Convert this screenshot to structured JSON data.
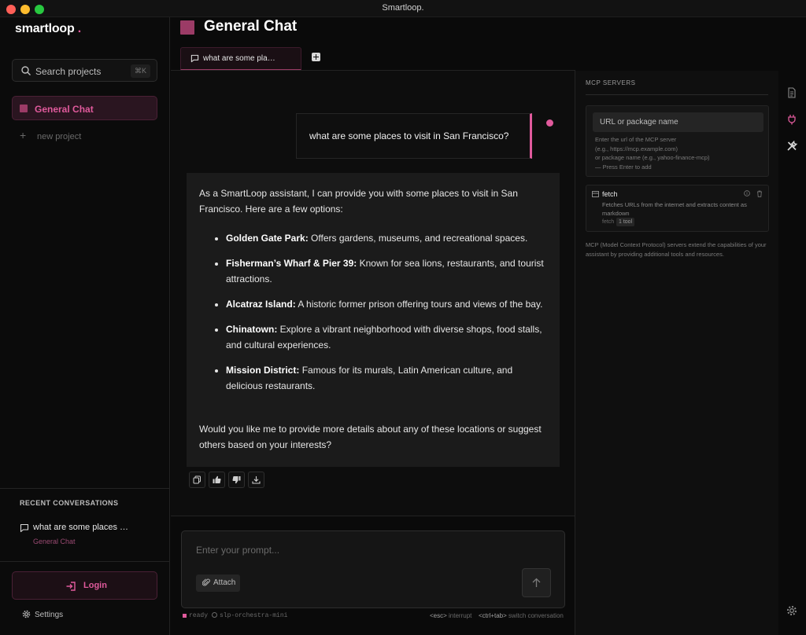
{
  "window": {
    "title": "Smartloop."
  },
  "sidebar": {
    "logo": "smartloop",
    "logo_dot": ".",
    "search": {
      "label": "Search projects",
      "shortcut": "⌘K"
    },
    "projects": [
      {
        "label": "General Chat"
      }
    ],
    "new_project_label": "new project",
    "recent_heading": "RECENT CONVERSATIONS",
    "recent": [
      {
        "title": "what are some places …",
        "project": "General Chat"
      }
    ],
    "login_label": "Login",
    "settings_label": "Settings"
  },
  "header": {
    "title": "General Chat",
    "tabs": [
      {
        "label": "what are some pla…"
      }
    ]
  },
  "chat": {
    "user_message": "what are some places to visit in San Francisco?",
    "assistant": {
      "intro": "As a SmartLoop assistant, I can provide you with some places to visit in San Francisco. Here are a few options:",
      "items": [
        {
          "title": "Golden Gate Park:",
          "text": " Offers gardens, museums, and recreational spaces."
        },
        {
          "title": "Fisherman’s Wharf & Pier 39:",
          "text": " Known for sea lions, restaurants, and tourist attractions."
        },
        {
          "title": "Alcatraz Island:",
          "text": " A historic former prison offering tours and views of the bay."
        },
        {
          "title": "Chinatown:",
          "text": " Explore a vibrant neighborhood with diverse shops, food stalls, and cultural experiences."
        },
        {
          "title": "Mission District:",
          "text": " Famous for its murals, Latin American culture, and delicious restaurants."
        }
      ],
      "outro": "Would you like me to provide more details about any of these locations or suggest others based on your interests?"
    }
  },
  "prompt": {
    "placeholder": "Enter your prompt...",
    "attach_label": "Attach"
  },
  "status": {
    "state": "ready",
    "model": "slp-orchestra-mini",
    "hint1_key": "<esc>",
    "hint1_text": " interrupt",
    "hint2_key": "<ctrl+tab>",
    "hint2_text": " switch conversation"
  },
  "mcp": {
    "heading": "MCP SERVERS",
    "input_placeholder": "URL or package name",
    "help_lines": [
      "Enter the url of the MCP server",
      "(e.g., https://mcp.example.com)",
      "or package name (e.g., yahoo-finance-mcp)",
      "— Press Enter to add"
    ],
    "servers": [
      {
        "name": "fetch",
        "description": "Fetches URLs from the internet and extracts content as markdown",
        "tag": "fetch",
        "badge": "1 tool"
      }
    ],
    "footer": "MCP (Model Context Protocol) servers extend the capabilities of your assistant by providing additional tools and resources."
  },
  "colors": {
    "accent": "#e05a9c",
    "project": "#9b3b66",
    "background": "#0a0a0a"
  },
  "icons": {
    "search": "search-icon",
    "chat": "chat-bubble-icon",
    "login": "login-icon",
    "settings": "gear-icon",
    "rail": [
      "document-icon",
      "plug-icon",
      "tools-icon",
      "gear-icon"
    ]
  }
}
